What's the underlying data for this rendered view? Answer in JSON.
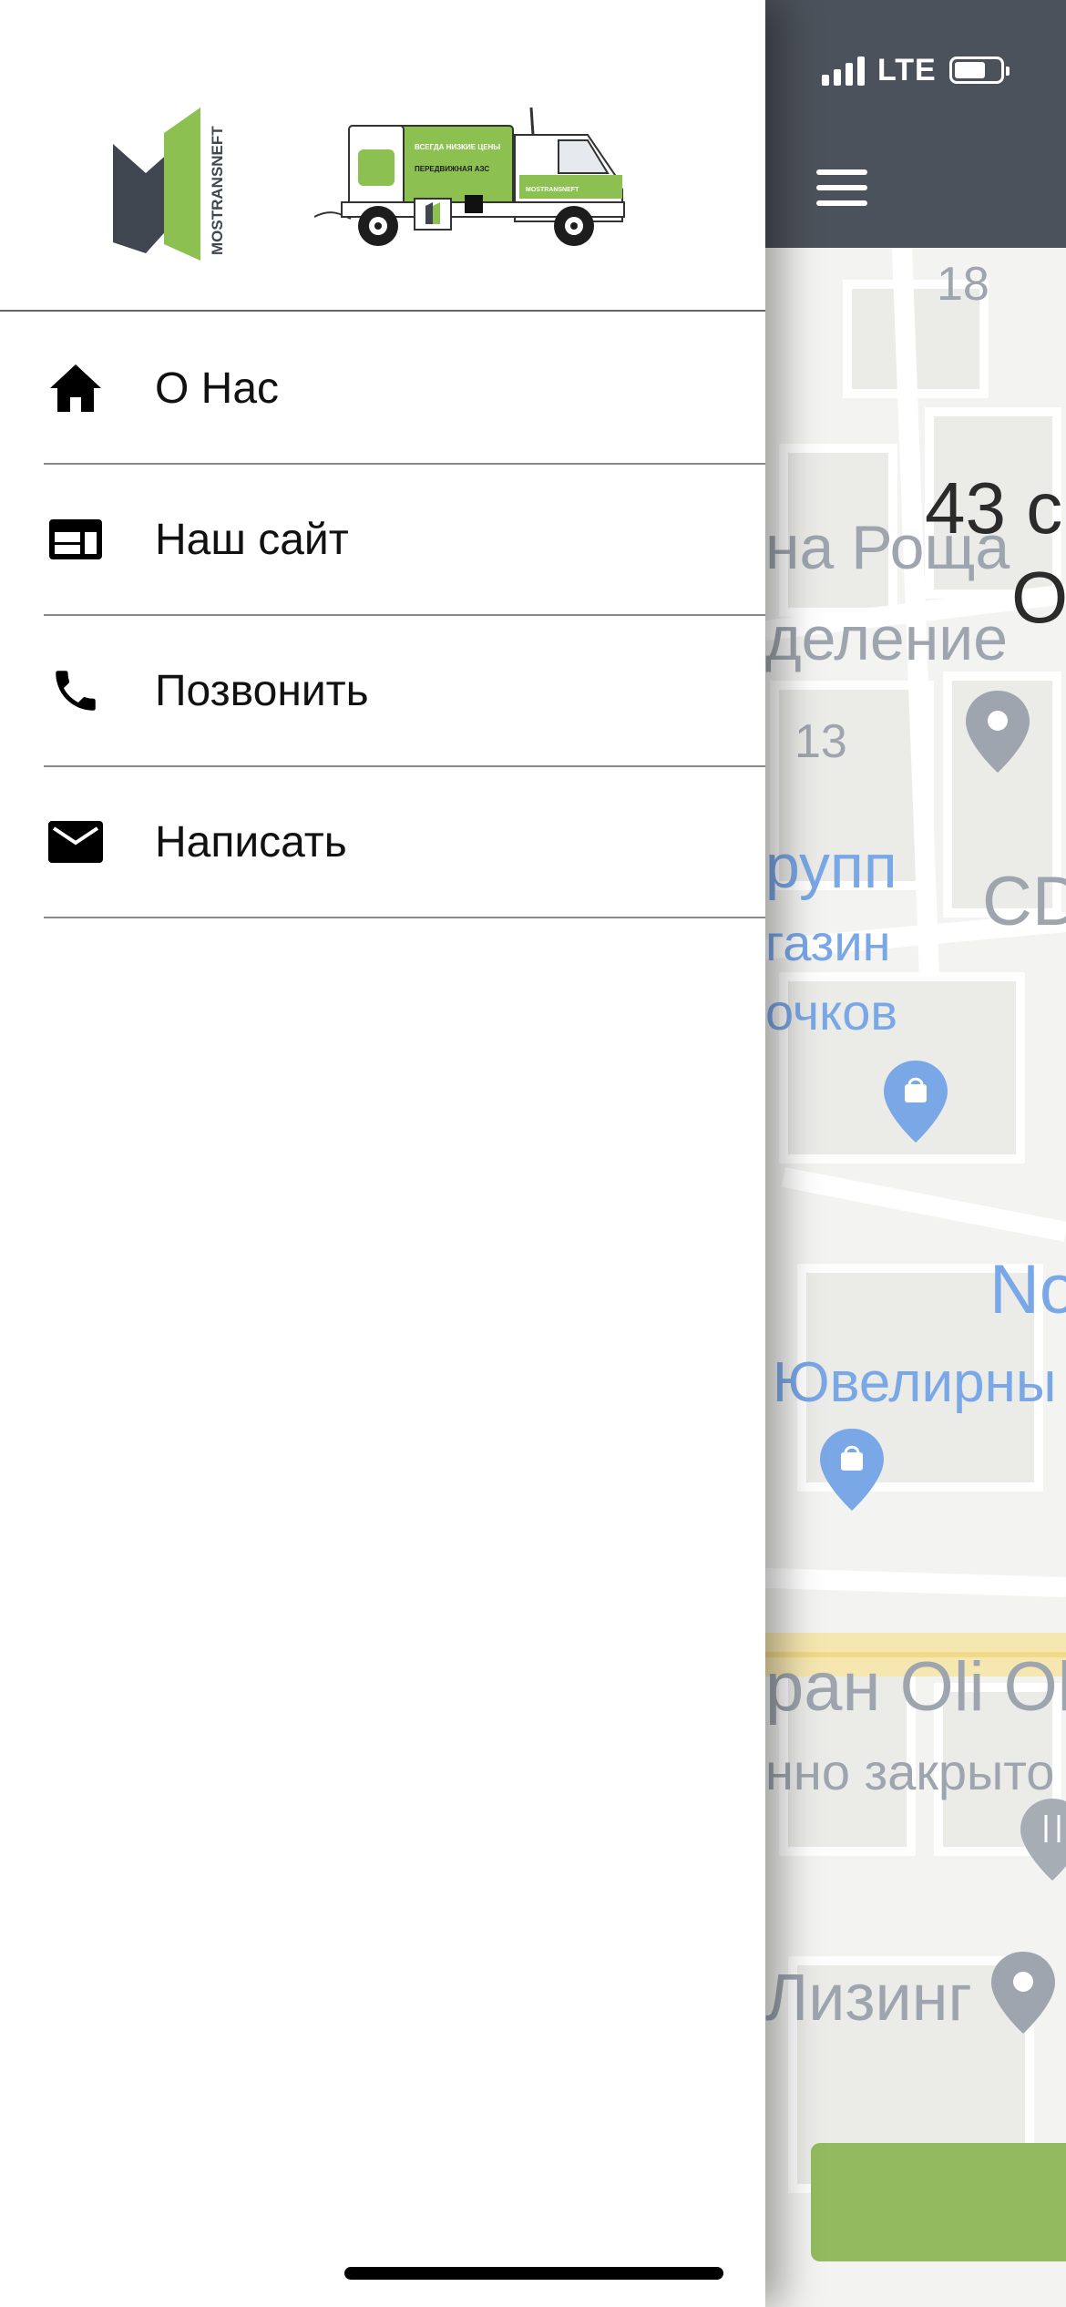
{
  "brand": {
    "logo_text": "MOSTRANSNEFT"
  },
  "truck": {
    "side_text_1": "ВСЕГДА НИЗКИЕ ЦЕНЫ",
    "side_text_2": "ПЕРЕДВИЖНАЯ АЗС",
    "door_text": "MOSTRANSNEFT"
  },
  "menu": [
    {
      "label": "О Нас",
      "icon": "home-icon"
    },
    {
      "label": "Наш сайт",
      "icon": "web-icon"
    },
    {
      "label": "Позвонить",
      "icon": "phone-icon"
    },
    {
      "label": "Написать",
      "icon": "mail-icon"
    }
  ],
  "status": {
    "network": "LTE"
  },
  "map": {
    "labels": [
      {
        "text": "18"
      },
      {
        "text": "43 с"
      },
      {
        "text": "О"
      },
      {
        "text": "на Роща"
      },
      {
        "text": "деление"
      },
      {
        "text": "13"
      },
      {
        "text": "рупп"
      },
      {
        "text": "газин"
      },
      {
        "text": "очков"
      },
      {
        "text": "CD"
      },
      {
        "text": "No"
      },
      {
        "text": "Ювелирны"
      },
      {
        "text": "ран Oli Ol"
      },
      {
        "text": "нно закрыто"
      },
      {
        "text": "Лизинг"
      }
    ]
  },
  "colors": {
    "accent_green": "#92bb5f",
    "header_dark": "#4c525b"
  }
}
